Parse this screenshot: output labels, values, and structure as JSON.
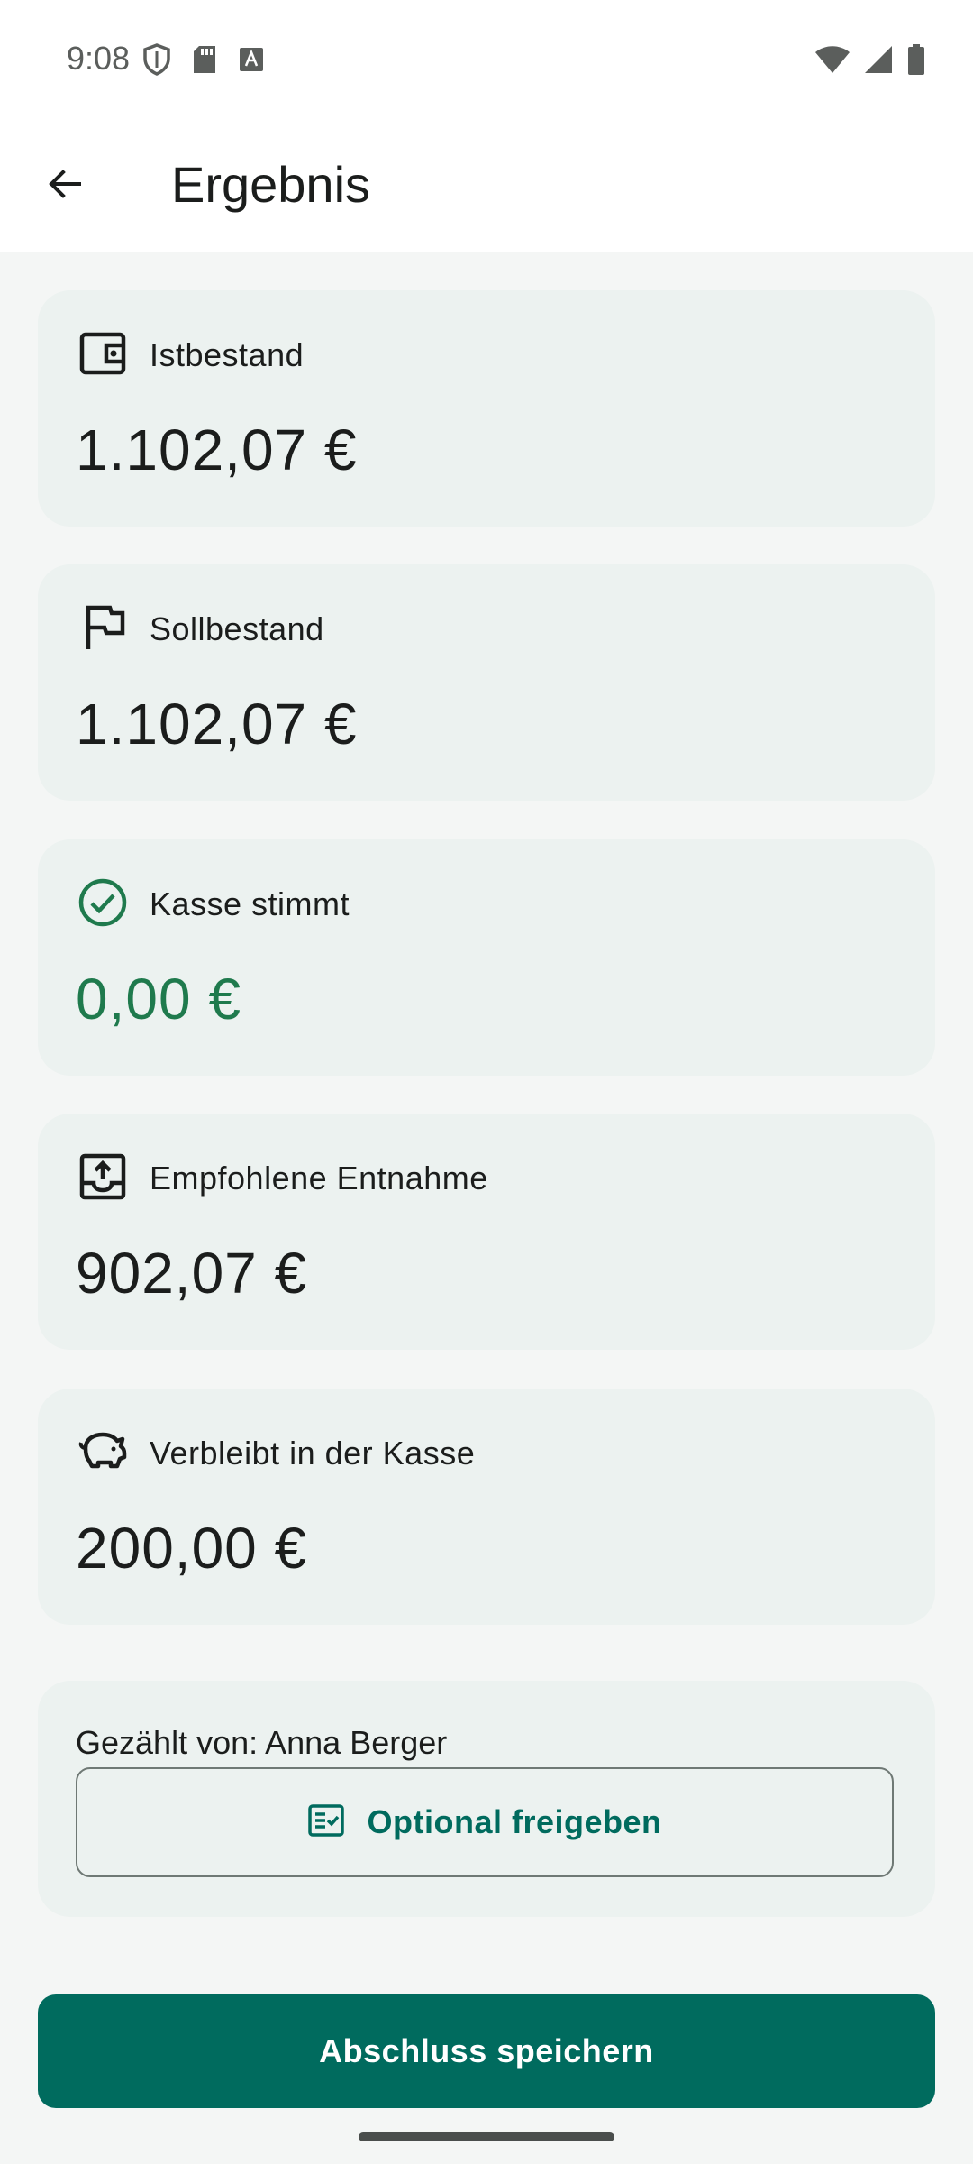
{
  "status_bar": {
    "time": "9:08",
    "left_icons": [
      "shield-icon",
      "sd-card-icon",
      "keyboard-a-icon"
    ],
    "right_icons": [
      "wifi-icon",
      "signal-icon",
      "battery-icon"
    ]
  },
  "app_bar": {
    "title": "Ergebnis",
    "back_icon": "arrow-back-icon"
  },
  "cards": [
    {
      "icon": "wallet-icon",
      "label": "Istbestand",
      "value": "1.102,07 €"
    },
    {
      "icon": "flag-icon",
      "label": "Sollbestand",
      "value": "1.102,07 €"
    },
    {
      "icon": "check-circle-icon",
      "label": "Kasse stimmt",
      "value": "0,00 €"
    },
    {
      "icon": "outbox-icon",
      "label": "Empfohlene Entnahme",
      "value": "902,07 €"
    },
    {
      "icon": "piggy-bank-icon",
      "label": "Verbleibt in der Kasse",
      "value": "200,00 €"
    }
  ],
  "counted": {
    "text": "Gezählt von: Anna Berger",
    "button_label": "Optional freigeben",
    "button_icon": "checklist-icon"
  },
  "primary_action": {
    "label": "Abschluss speichern"
  },
  "colors": {
    "accent": "#006b5e",
    "success": "#1f7a4d",
    "card_background": "#ecf2f0",
    "page_background": "#f4f6f5"
  }
}
